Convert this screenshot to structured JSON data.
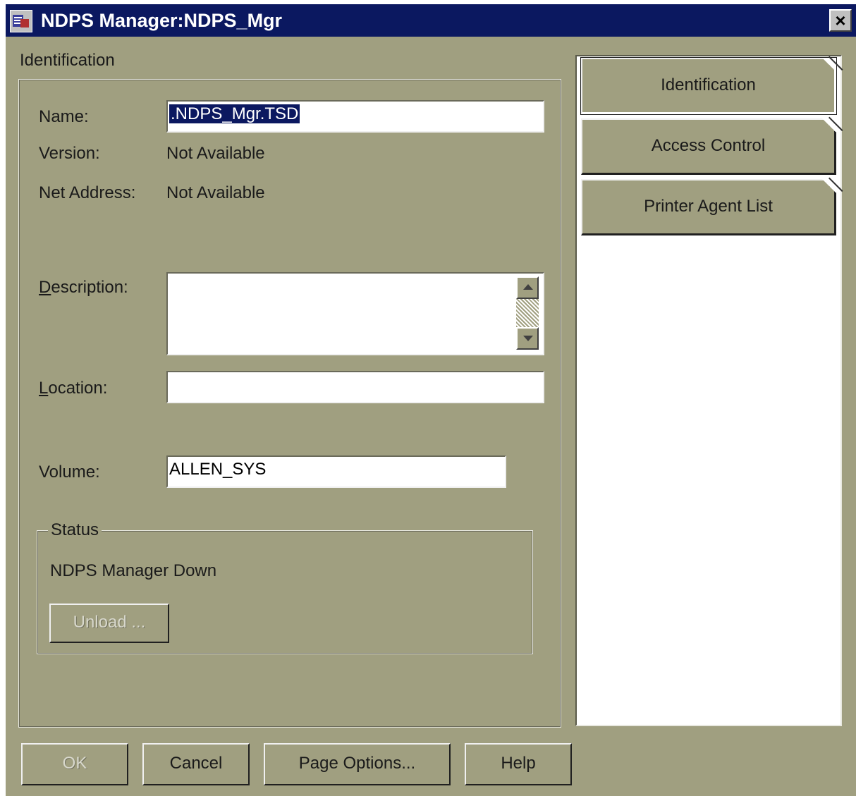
{
  "window": {
    "title": "NDPS Manager:NDPS_Mgr",
    "close_label": "×"
  },
  "section_title": "Identification",
  "form": {
    "name_label": "Name:",
    "name_value": ".NDPS_Mgr.TSD",
    "version_label": "Version:",
    "version_value": "Not Available",
    "net_address_label": "Net Address:",
    "net_address_value": "Not Available",
    "description_label_mnemonic": "D",
    "description_label_rest": "escription:",
    "description_value": "",
    "location_label_mnemonic": "L",
    "location_label_rest": "ocation:",
    "location_value": "",
    "volume_label": "Volume:",
    "volume_value": "ALLEN_SYS"
  },
  "status": {
    "legend": "Status",
    "text": "NDPS Manager Down",
    "unload_label": "Unload ..."
  },
  "pages": [
    {
      "label": "Identification",
      "active": true
    },
    {
      "label": "Access Control",
      "active": false
    },
    {
      "label": "Printer Agent List",
      "active": false
    }
  ],
  "buttons": {
    "ok": "OK",
    "cancel": "Cancel",
    "page_options": "Page Options...",
    "help": "Help"
  },
  "colors": {
    "dialog_bg": "#a09f80",
    "titlebar_bg": "#0b1860",
    "selection_bg": "#0b1860"
  }
}
